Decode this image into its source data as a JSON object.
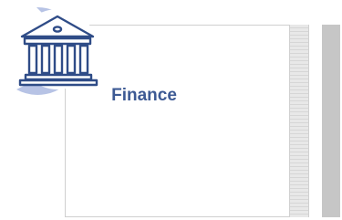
{
  "card": {
    "title": "Finance",
    "icon": "bank-icon"
  },
  "colors": {
    "title": "#3d5a94",
    "icon_stroke": "#2f4c87",
    "icon_shadow": "#aab8e0",
    "scroll_bar": "#c6c6c6"
  }
}
